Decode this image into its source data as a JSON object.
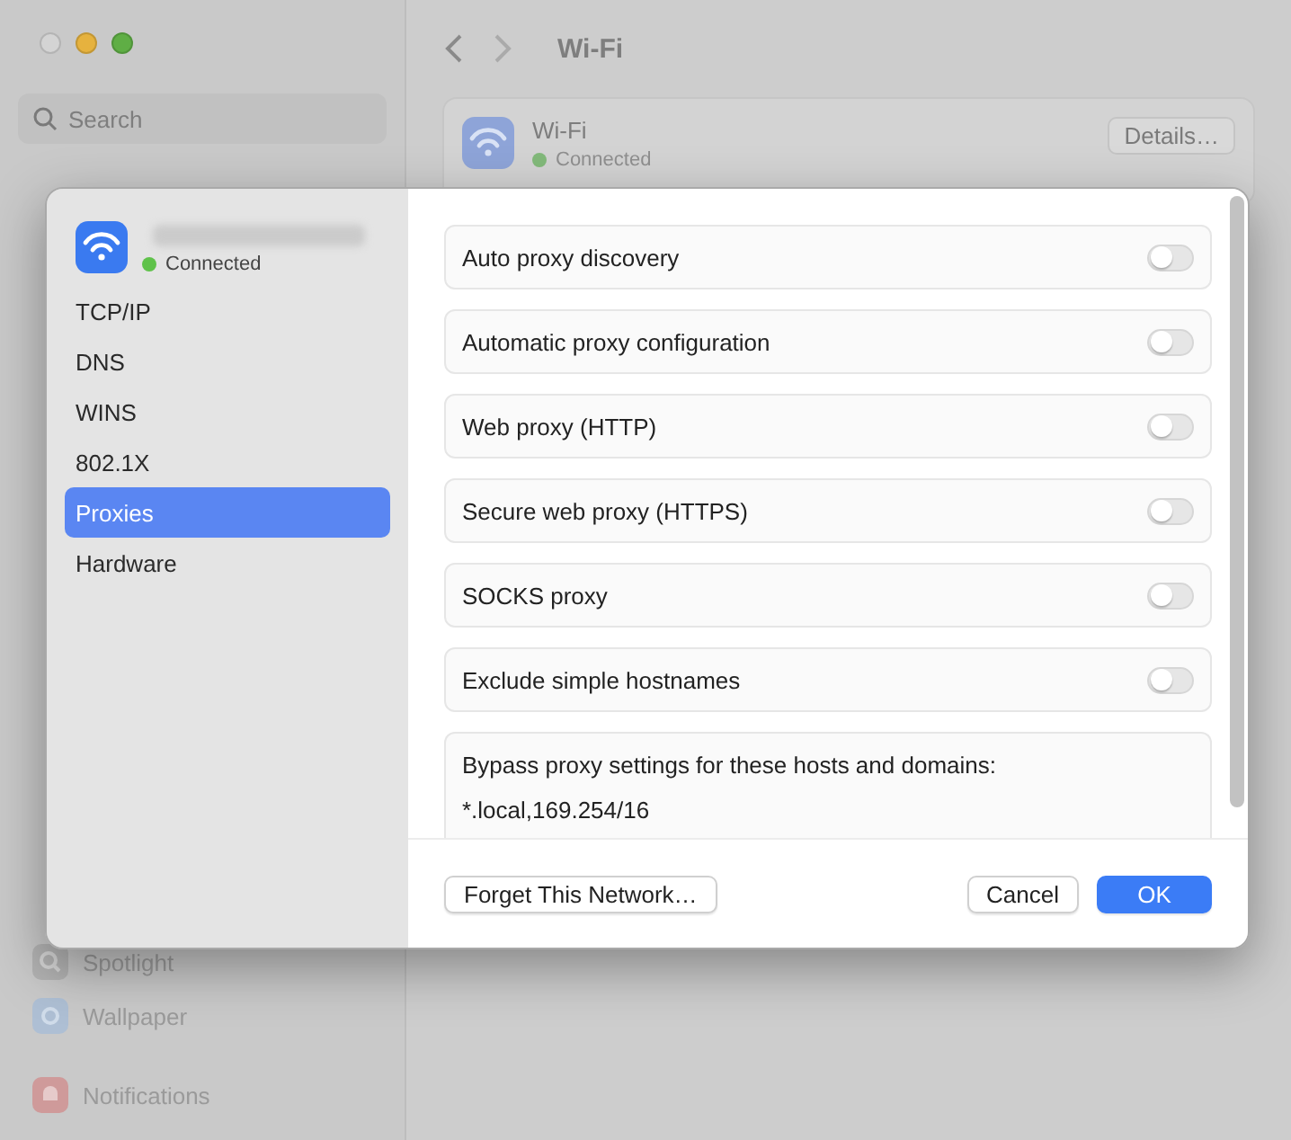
{
  "background": {
    "search": {
      "placeholder": "Search"
    },
    "sidebar_items": [
      {
        "label": "Spotlight",
        "kind": "spotlight"
      },
      {
        "label": "Wallpaper",
        "kind": "wallpaper"
      },
      {
        "label": "Notifications",
        "kind": "notifications"
      }
    ],
    "title": "Wi-Fi",
    "network": {
      "name": "Wi-Fi",
      "status": "Connected",
      "button": "Details…"
    }
  },
  "sheet": {
    "network": {
      "status": "Connected"
    },
    "tabs": [
      {
        "label": "TCP/IP",
        "selected": false
      },
      {
        "label": "DNS",
        "selected": false
      },
      {
        "label": "WINS",
        "selected": false
      },
      {
        "label": "802.1X",
        "selected": false
      },
      {
        "label": "Proxies",
        "selected": true
      },
      {
        "label": "Hardware",
        "selected": false
      }
    ],
    "options": [
      {
        "label": "Auto proxy discovery",
        "on": false
      },
      {
        "label": "Automatic proxy configuration",
        "on": false
      },
      {
        "label": "Web proxy (HTTP)",
        "on": false
      },
      {
        "label": "Secure web proxy (HTTPS)",
        "on": false
      },
      {
        "label": "SOCKS proxy",
        "on": false
      },
      {
        "label": "Exclude simple hostnames",
        "on": false
      }
    ],
    "bypass": {
      "label": "Bypass proxy settings for these hosts and domains:",
      "value": "*.local,169.254/16"
    },
    "buttons": {
      "forget": "Forget This Network…",
      "cancel": "Cancel",
      "ok": "OK"
    }
  }
}
